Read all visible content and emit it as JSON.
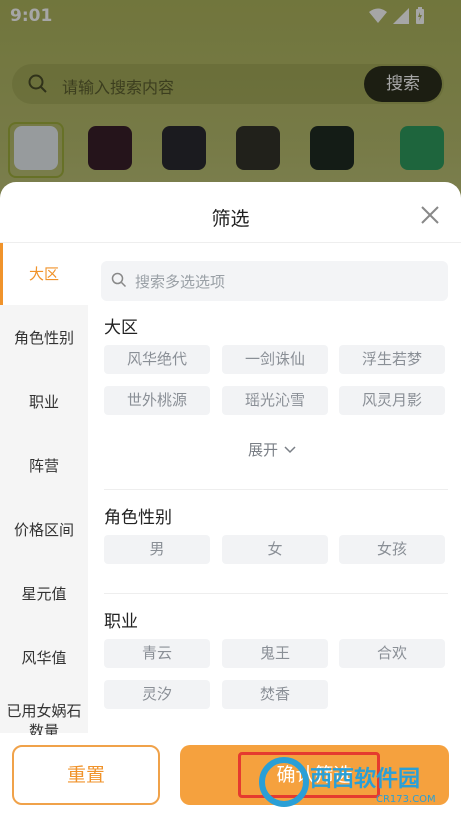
{
  "status": {
    "time": "9:01"
  },
  "search": {
    "placeholder": "请输入搜索内容",
    "button_label": "搜索"
  },
  "sheet": {
    "title": "筛选",
    "filter_search_placeholder": "搜索多选选项",
    "expand_label": "展开",
    "reset_label": "重置",
    "confirm_label": "确认筛选"
  },
  "sidebar": {
    "items": [
      {
        "label": "大区",
        "active": true
      },
      {
        "label": "角色性别"
      },
      {
        "label": "职业"
      },
      {
        "label": "阵营"
      },
      {
        "label": "价格区间"
      },
      {
        "label": "星元值"
      },
      {
        "label": "风华值"
      },
      {
        "label": "已用女娲石数量"
      }
    ]
  },
  "sections": {
    "region": {
      "title": "大区",
      "options": [
        "风华绝代",
        "一剑诛仙",
        "浮生若梦",
        "世外桃源",
        "瑶光沁雪",
        "风灵月影"
      ]
    },
    "gender": {
      "title": "角色性别",
      "options": [
        "男",
        "女",
        "女孩"
      ]
    },
    "profession": {
      "title": "职业",
      "options": [
        "青云",
        "鬼王",
        "合欢",
        "灵汐",
        "焚香"
      ]
    }
  },
  "watermark": {
    "text": "西西软件园",
    "sub": "CR173.COM"
  },
  "colors": {
    "accent": "#f0932b",
    "confirm_bg": "#f5a13e",
    "highlight_box": "#e53b2f"
  }
}
